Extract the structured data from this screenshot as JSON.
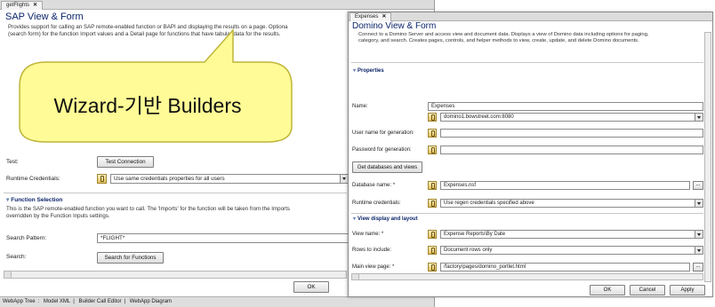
{
  "left_window": {
    "tab_label": "getFlights",
    "close_glyph": "✕",
    "title": "SAP View & Form",
    "description": [
      "Provides support for calling an SAP remote-enabled function or BAPI and displaying the results on a page.  Optiona",
      "(search form) for the function Import values and a Detail page for functions that have tabular data for the results."
    ],
    "test_label": "Test:",
    "test_button": "Test Connection",
    "runtime_credentials_label": "Runtime Credentials:",
    "runtime_credentials_value": "Use same credentials properties for all users",
    "function_section": "Function Selection",
    "function_desc": [
      "This is the SAP remote-enabled function you want to call.  The 'Imports' for the function will be taken from the Imports",
      "overridden by the Function Inputs settings."
    ],
    "search_pattern_label": "Search Pattern:",
    "search_pattern_value": "*FLIGHT*",
    "search_label": "Search:",
    "search_button": "Search for Functions",
    "ok_button": "OK",
    "bottom_tabs": [
      "WebApp Tree",
      "Model XML",
      "Builder Call Editor",
      "WebApp Diagram"
    ],
    "bottom_tab_separators": [
      ":",
      "|",
      "|"
    ]
  },
  "right_window": {
    "tab_label": "Expenses",
    "close_glyph": "✕",
    "title": "Domino View & Form",
    "description": [
      "Connect to a Domino Server and access view and document data.  Displays a view of Domino data including options for paging,",
      "category, and search.  Creates pages, controls, and helper methods to view, create, update, and delete Domino documents."
    ],
    "properties_section": "Properties",
    "name_label": "Name:",
    "name_value": "Expenses",
    "server_value": "domino1.bowstreet.com:8080",
    "username_label": "User name for generation:",
    "password_label": "Password for generation:",
    "get_databases_button": "Get databases and views",
    "database_name_label": "Database name:",
    "database_name_value": "Expenses.nsf",
    "runtime_credentials_label": "Runtime credentials:",
    "runtime_credentials_value": "Use regen credentials specified above",
    "view_section": "View display and layout",
    "view_name_label": "View name:",
    "view_name_value": "Expense Reports\\By Date",
    "rows_label": "Rows to include:",
    "rows_value": "Document rows only",
    "main_view_page_label": "Main view page:",
    "main_view_page_value": "/factory/pages/domino_portlet.html",
    "required_mark": "*",
    "ellipsis": "...",
    "ok_button": "OK",
    "cancel_button": "Cancel",
    "apply_button": "Apply"
  },
  "callout": {
    "text": "Wizard-기반 Builders",
    "fill_color": "#fffb96",
    "border_color": "#bfb53a"
  },
  "colors": {
    "title_blue": "#0a246a",
    "section_chevron": "#6a86b8"
  }
}
